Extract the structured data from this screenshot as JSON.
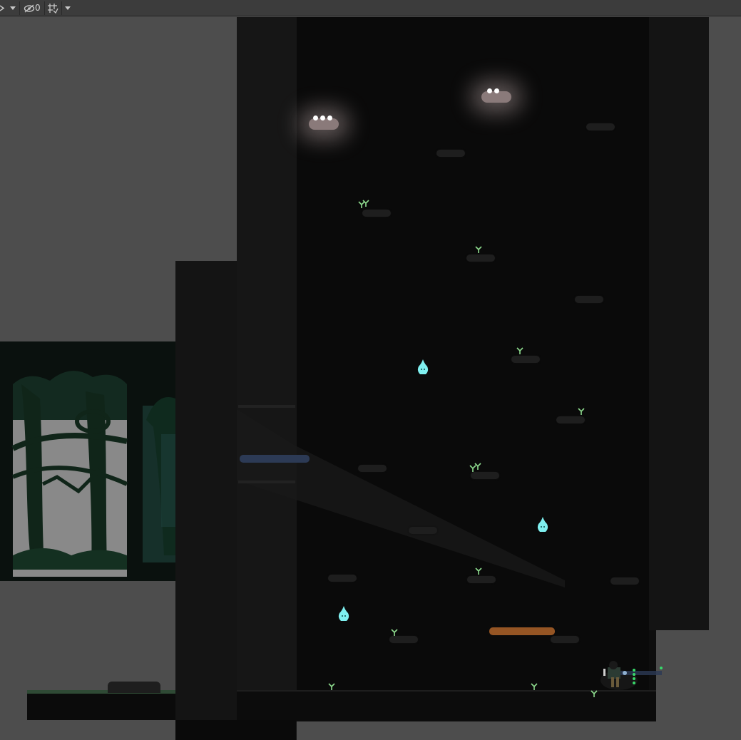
{
  "toolbar": {
    "hidden_count": "0",
    "icons": [
      "dropdown-caret",
      "visibility-hidden-icon",
      "grid-snap-icon",
      "dropdown-caret"
    ]
  },
  "colors": {
    "editor_background": "#4d4d4d",
    "toolbar_background": "#3c3c3c",
    "forest_dark": "#0b0b0b",
    "silhouette_green": "#0f2a1e",
    "sky_gray": "#8c8c8c",
    "wisp_cyan": "#7ff0f0",
    "sprout_green": "#8fdc8f",
    "nest_glow": "#ffe6e6",
    "orange_platform": "#b8682a",
    "blue_platform": "#2c3a55",
    "grass_green": "#2f4a35"
  },
  "scene": {
    "sprite_names": [
      "glowing-nest",
      "glowing-nest",
      "spirit-wisp",
      "spirit-wisp",
      "spirit-wisp",
      "player-character",
      "sprout",
      "orange-moving-platform",
      "blue-moving-platform",
      "tree-stump"
    ]
  }
}
